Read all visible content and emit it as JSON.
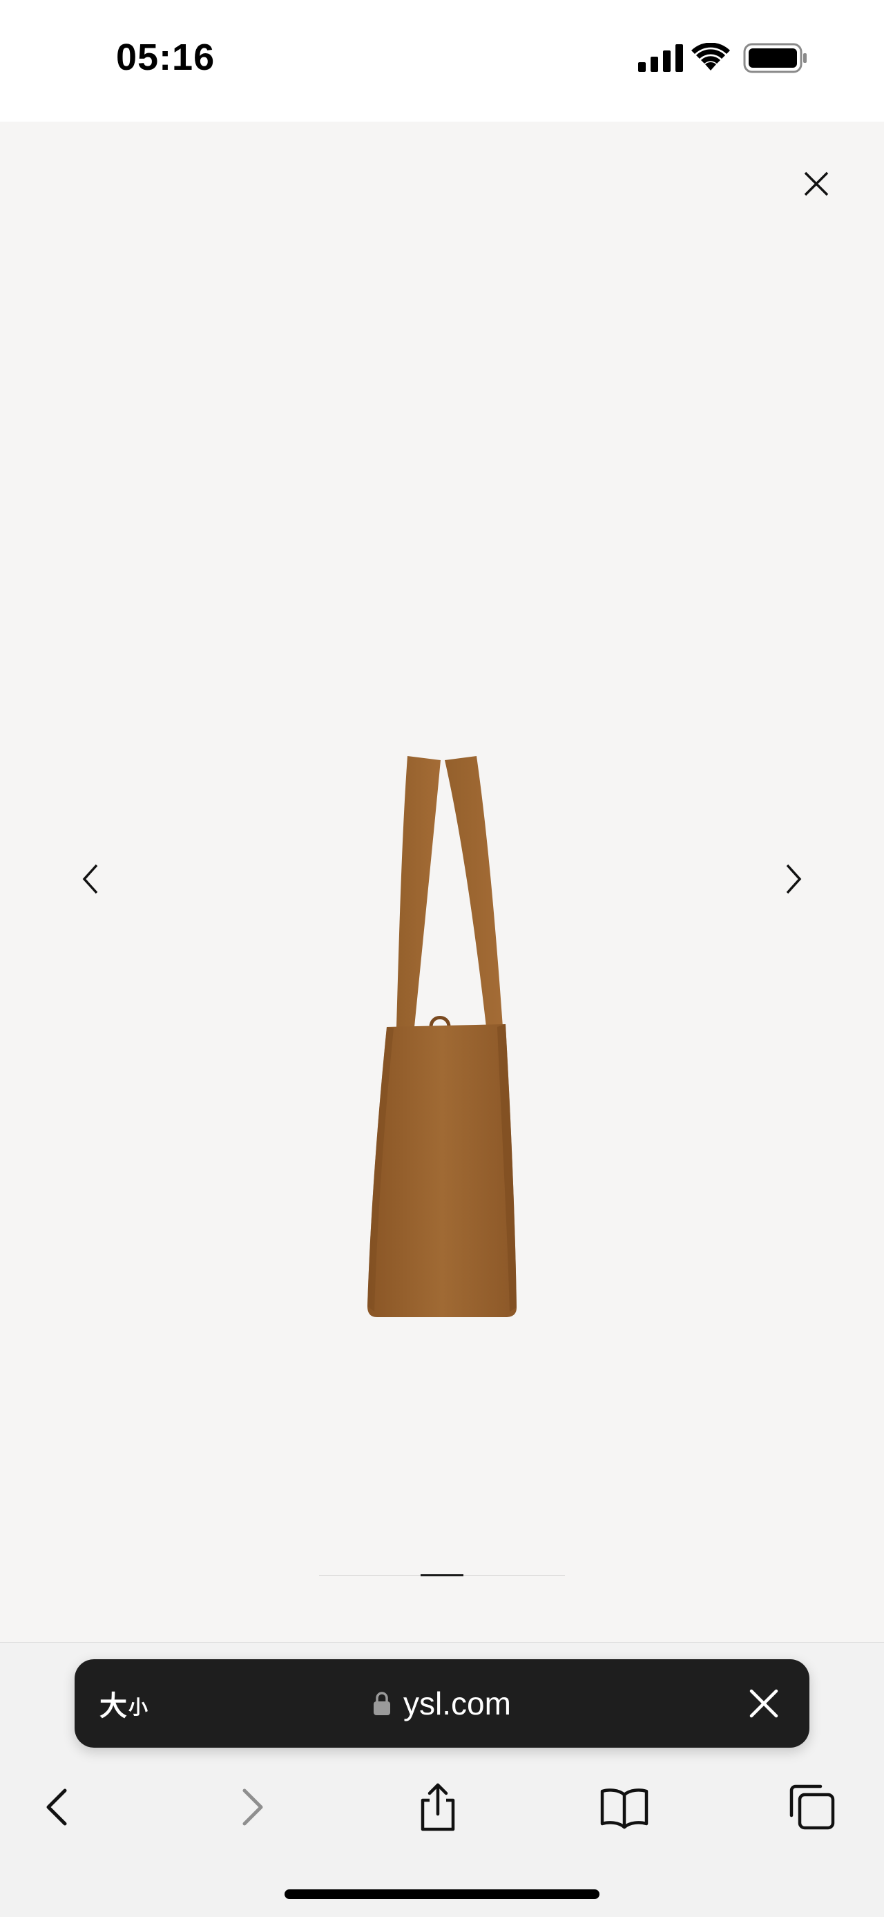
{
  "status_bar": {
    "time": "05:16",
    "icons": [
      "cellular-signal-icon",
      "wifi-icon",
      "battery-icon"
    ]
  },
  "viewer": {
    "close_icon": "close-icon",
    "prev_icon": "chevron-left-icon",
    "next_icon": "chevron-right-icon",
    "product_color": "#9a6430",
    "background_color": "#f6f5f4",
    "pager": {
      "current": 2,
      "total": 3
    }
  },
  "address_bar": {
    "text_size_big": "大",
    "text_size_small": "小",
    "url": "ysl.com",
    "lock_icon": "lock-icon",
    "close_icon": "close-icon"
  },
  "toolbar": {
    "buttons": [
      "back-icon",
      "forward-icon",
      "share-icon",
      "bookmarks-icon",
      "tabs-icon"
    ]
  }
}
